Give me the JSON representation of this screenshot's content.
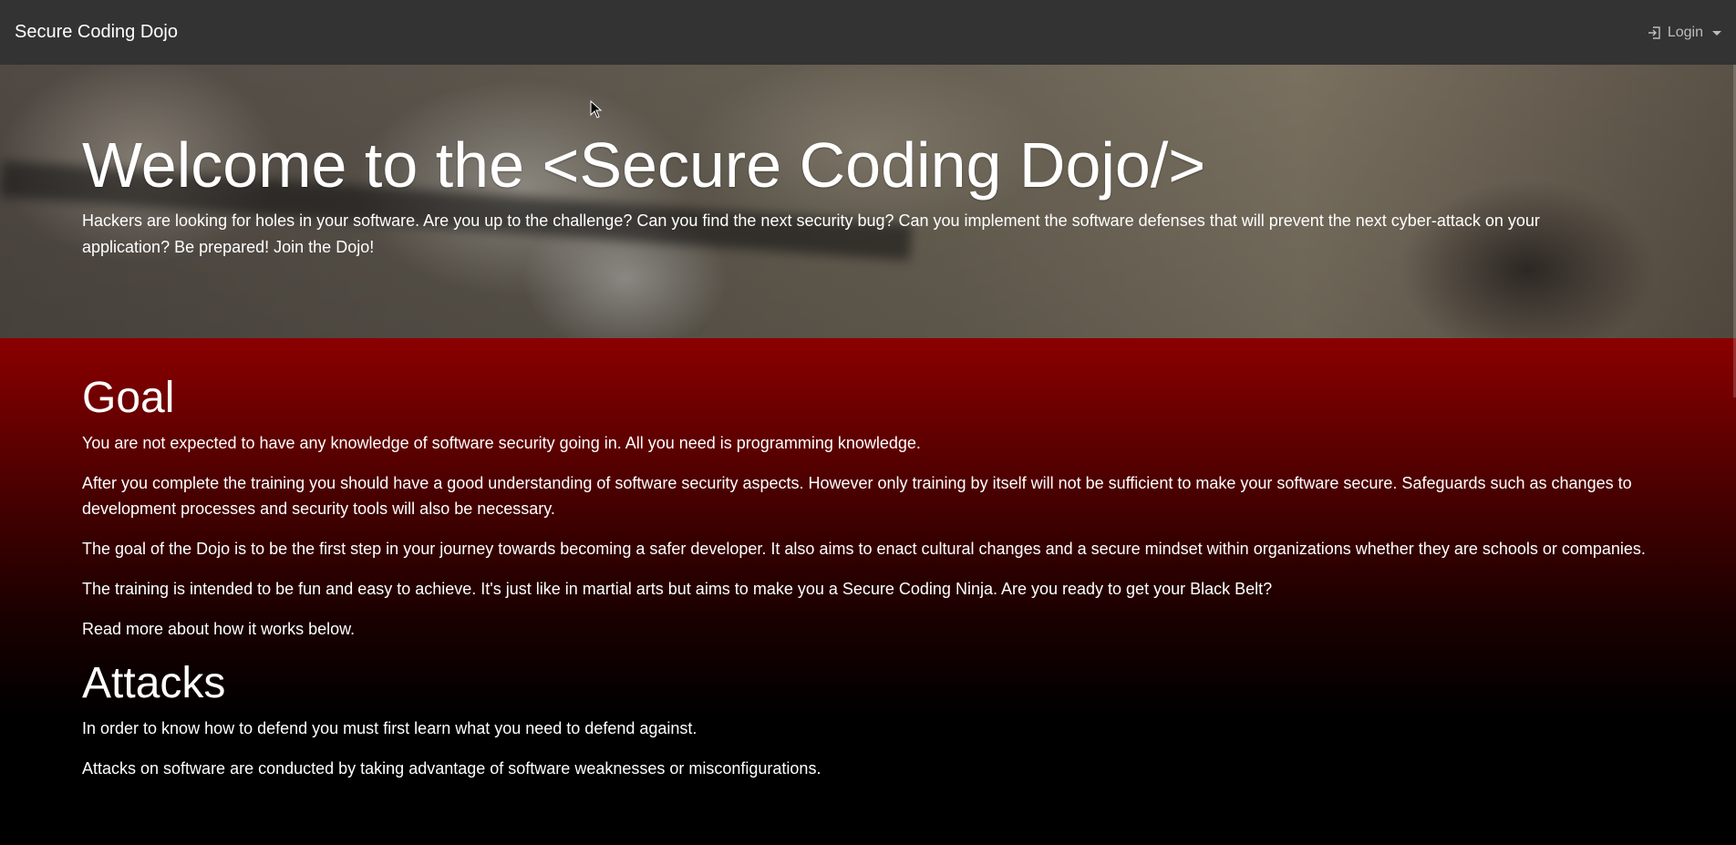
{
  "navbar": {
    "brand": "Secure Coding Dojo",
    "login_label": "Login",
    "login_icon": "login-arrow-icon"
  },
  "hero": {
    "title": "Welcome to the <Secure Coding Dojo/>",
    "lead": "Hackers are looking for holes in your software. Are you up to the challenge? Can you find the next security bug? Can you implement the software defenses that will prevent the next cyber-attack on your application? Be prepared! Join the Dojo!"
  },
  "goal": {
    "title": "Goal",
    "paragraphs": [
      "You are not expected to have any knowledge of software security going in. All you need is programming knowledge.",
      "After you complete the training you should have a good understanding of software security aspects. However only training by itself will not be sufficient to make your software secure. Safeguards such as changes to development processes and security tools will also be necessary.",
      "The goal of the Dojo is to be the first step in your journey towards becoming a safer developer. It also aims to enact cultural changes and a secure mindset within organizations whether they are schools or companies.",
      "The training is intended to be fun and easy to achieve. It's just like in martial arts but aims to make you a Secure Coding Ninja. Are you ready to get your Black Belt?",
      "Read more about how it works below."
    ]
  },
  "attacks": {
    "title": "Attacks",
    "paragraphs": [
      "In order to know how to defend you must first learn what you need to defend against.",
      "Attacks on software are conducted by taking advantage of software weaknesses or misconfigurations."
    ]
  },
  "colors": {
    "navbar_bg": "#333333",
    "accent_red": "#8b0000",
    "text": "#ffffff"
  }
}
